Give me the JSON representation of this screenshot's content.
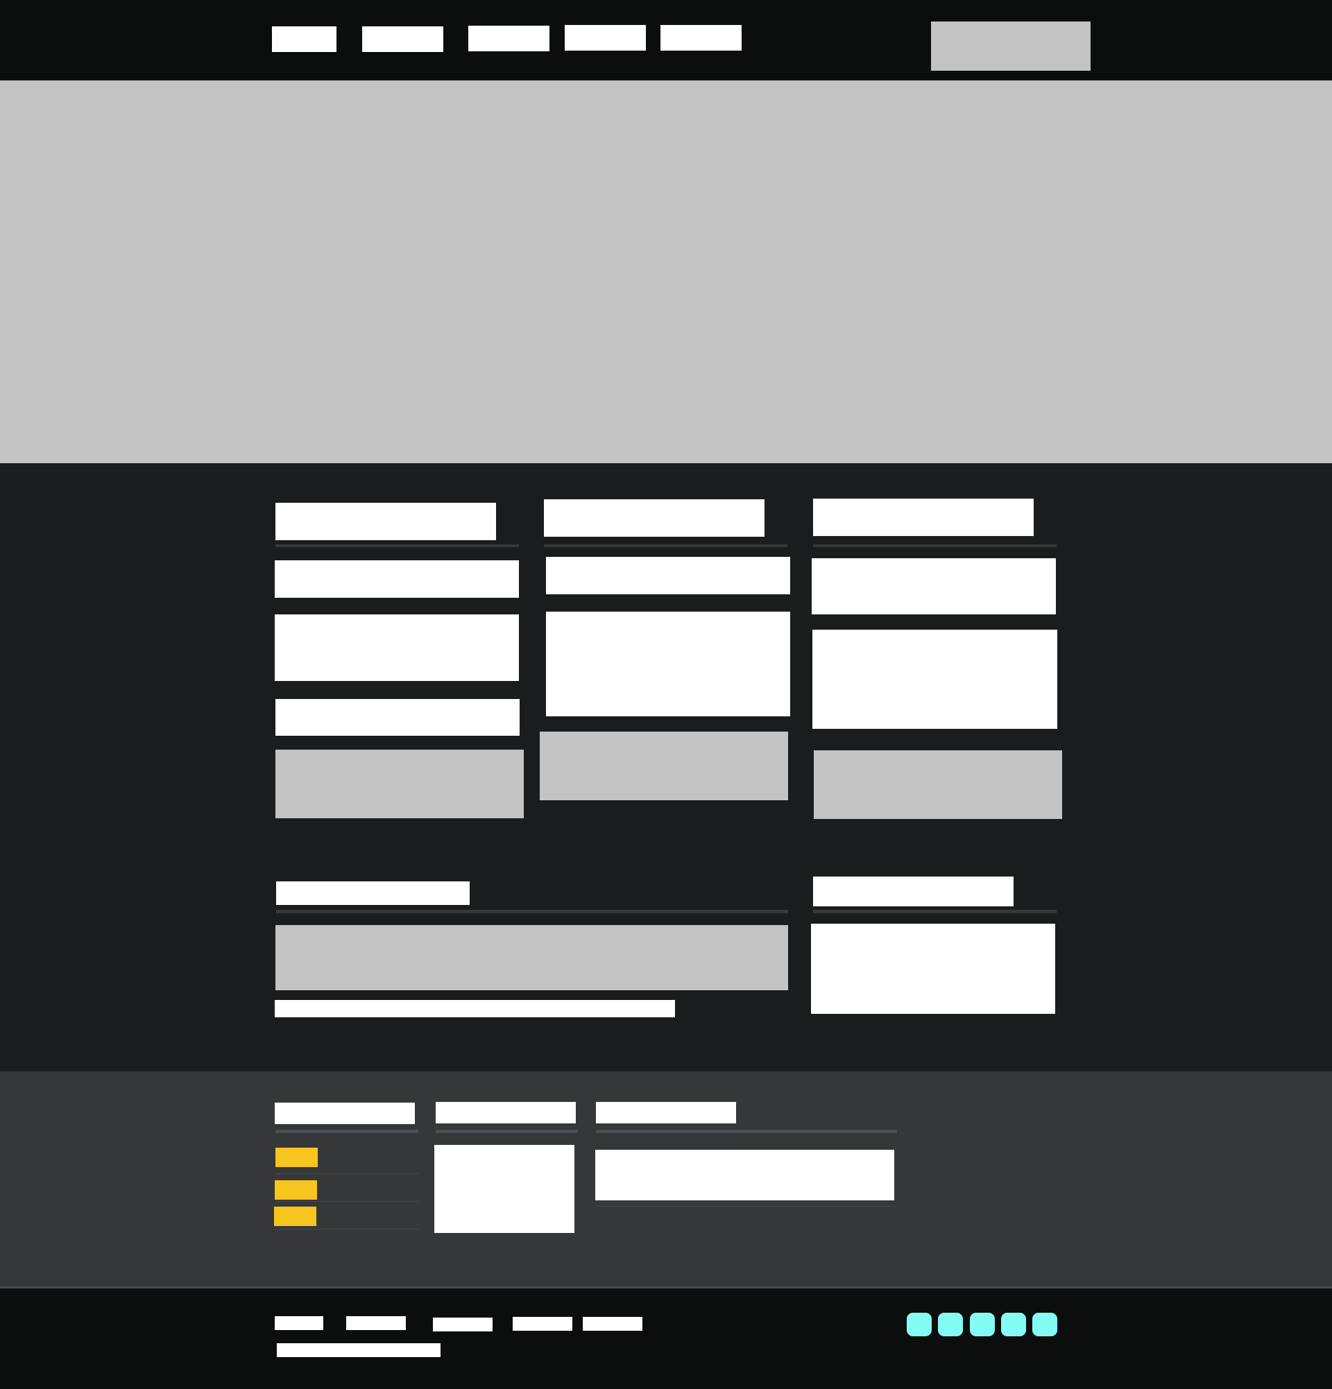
{
  "nav": {
    "items": [
      {
        "label": ""
      },
      {
        "label": ""
      },
      {
        "label": ""
      },
      {
        "label": ""
      },
      {
        "label": ""
      }
    ],
    "search_placeholder": ""
  },
  "hero": {
    "caption": ""
  },
  "columns": [
    {
      "heading": "",
      "subheading": "",
      "body": "",
      "meta": ""
    },
    {
      "heading": "",
      "subheading": "",
      "body": "",
      "meta": ""
    },
    {
      "heading": "",
      "subheading": "",
      "body": "",
      "meta": ""
    }
  ],
  "wide_section": {
    "heading": "",
    "caption": ""
  },
  "side_section": {
    "heading": "",
    "body": ""
  },
  "footer_widgets": {
    "col1": {
      "heading": "",
      "tags": [
        "",
        "",
        ""
      ]
    },
    "col2": {
      "heading": "",
      "body": ""
    },
    "col3": {
      "heading": "",
      "body": ""
    }
  },
  "bottom_nav": {
    "items": [
      "",
      "",
      "",
      "",
      ""
    ],
    "copyright": ""
  },
  "social": {
    "icons": [
      "social-icon-1",
      "social-icon-2",
      "social-icon-3",
      "social-icon-4",
      "social-icon-5"
    ]
  },
  "colors": {
    "topbar": "#0c0e0e",
    "main_bg": "#1b1c1e",
    "footer_bg": "#353739",
    "placeholder_grey": "#c3c3c3",
    "tag_yellow": "#f7c51e",
    "social_cyan": "#85fbf6"
  }
}
